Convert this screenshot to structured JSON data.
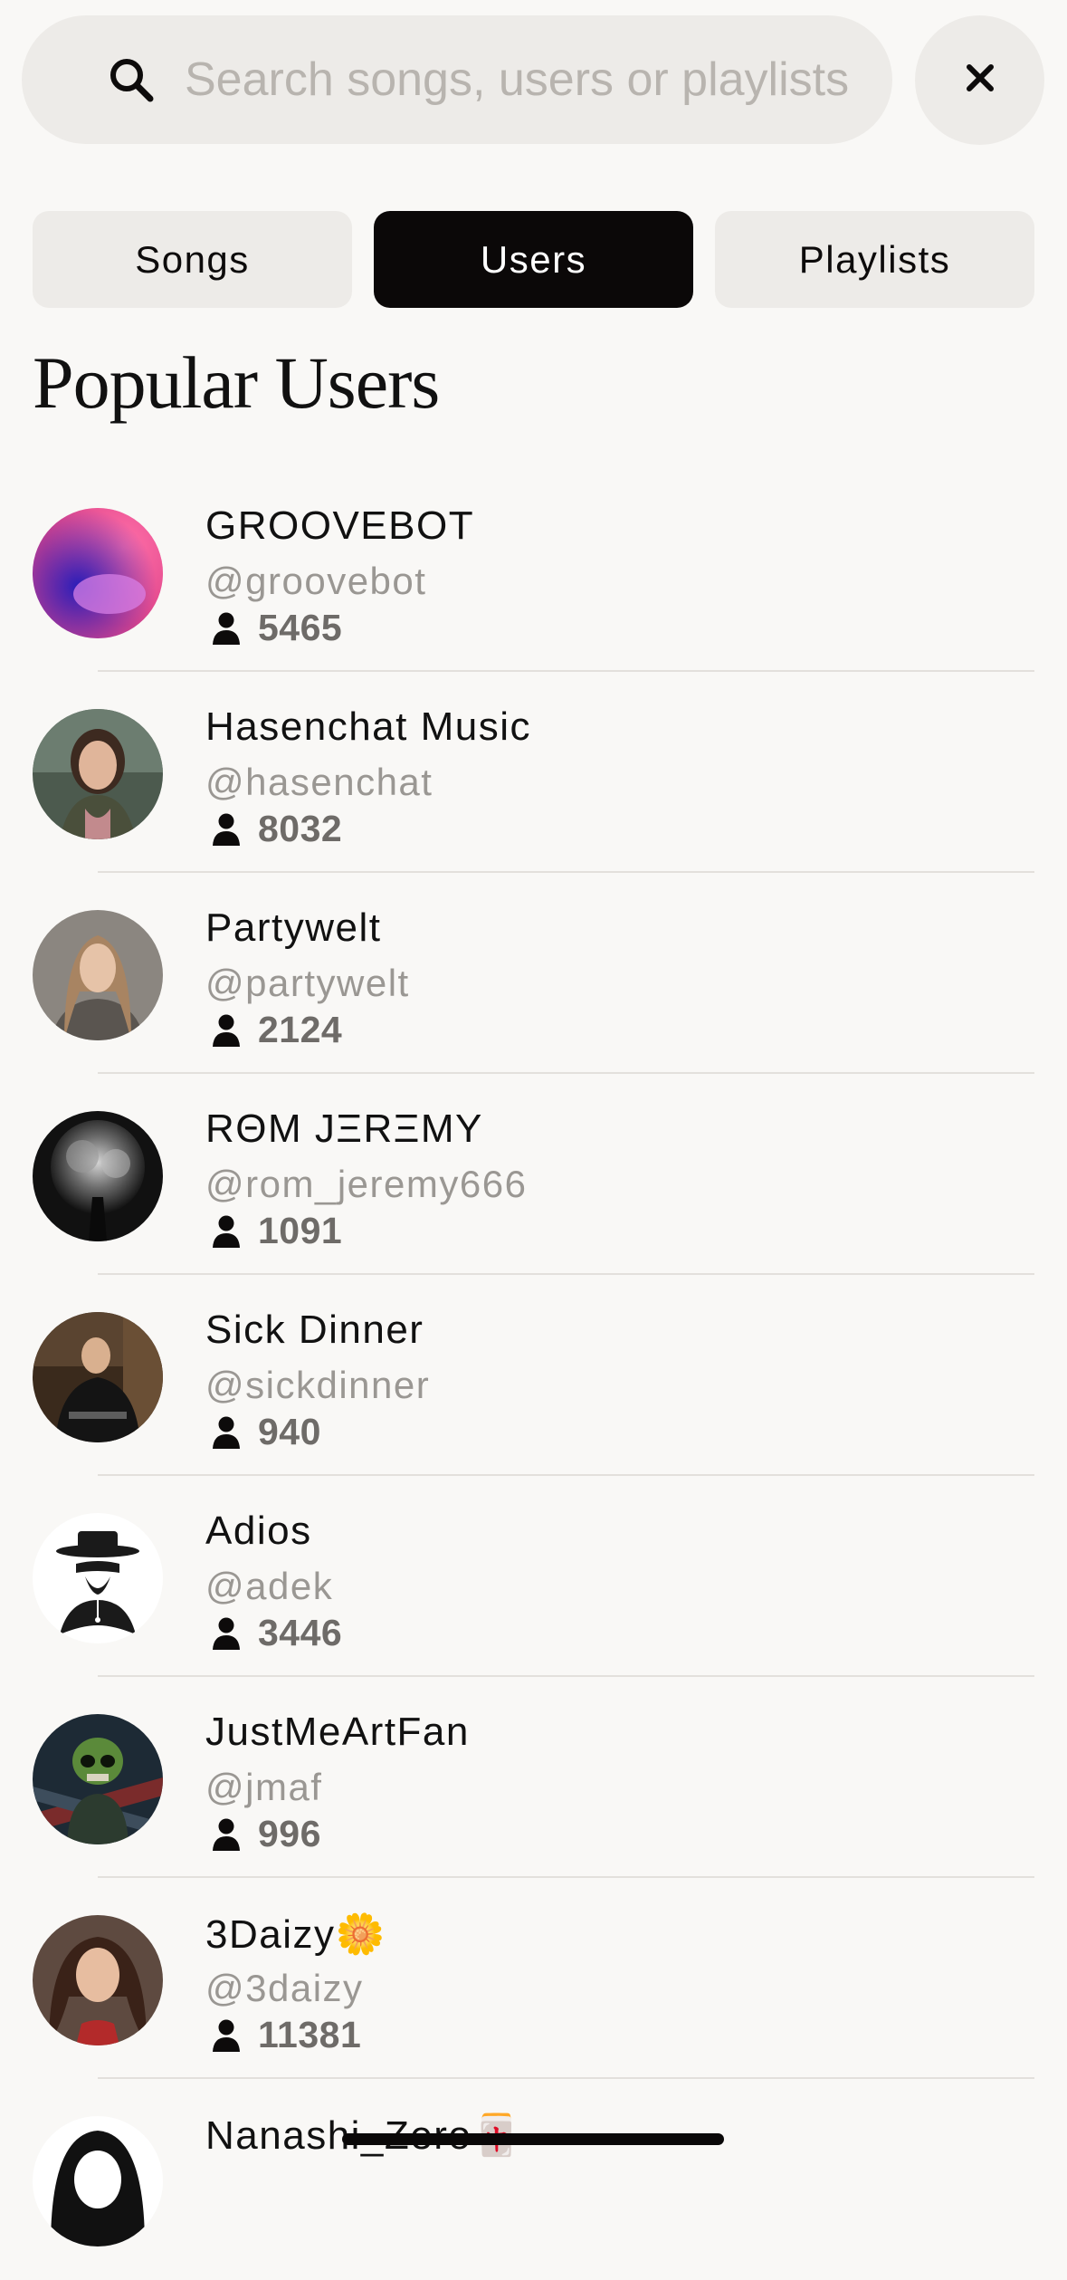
{
  "search": {
    "placeholder": "Search songs, users or playlists",
    "icon": "search-icon"
  },
  "close": {
    "icon": "close-icon"
  },
  "tabs": [
    {
      "label": "Songs",
      "active": false
    },
    {
      "label": "Users",
      "active": true
    },
    {
      "label": "Playlists",
      "active": false
    }
  ],
  "section": {
    "title": "Popular Users"
  },
  "users": [
    {
      "name": "GROOVEBOT",
      "handle": "@groovebot",
      "followers": "5465",
      "avatar": "gradient-blob"
    },
    {
      "name": "Hasenchat Music",
      "handle": "@hasenchat",
      "followers": "8032",
      "avatar": "portrait"
    },
    {
      "name": "Partywelt",
      "handle": "@partywelt",
      "followers": "2124",
      "avatar": "portrait"
    },
    {
      "name": "RΘM JΞRΞMY",
      "handle": "@rom_jeremy666",
      "followers": "1091",
      "avatar": "smoke"
    },
    {
      "name": "Sick Dinner",
      "handle": "@sickdinner",
      "followers": "940",
      "avatar": "portrait"
    },
    {
      "name": "Adios",
      "handle": "@adek",
      "followers": "3446",
      "avatar": "masked-bandit"
    },
    {
      "name": "JustMeArtFan",
      "handle": "@jmaf",
      "followers": "996",
      "avatar": "skull-art"
    },
    {
      "name": "3Daizy🌼",
      "handle": "@3daizy",
      "followers": "11381",
      "avatar": "portrait"
    },
    {
      "name": "Nanashi_Zero🀄",
      "handle": "",
      "followers": "",
      "avatar": "portrait"
    }
  ],
  "colors": {
    "background": "#f9f8f6",
    "chip": "#edebe8",
    "active_tab": "#0b0808",
    "handle_text": "#9a9793",
    "follower_text": "#6e6b68"
  }
}
